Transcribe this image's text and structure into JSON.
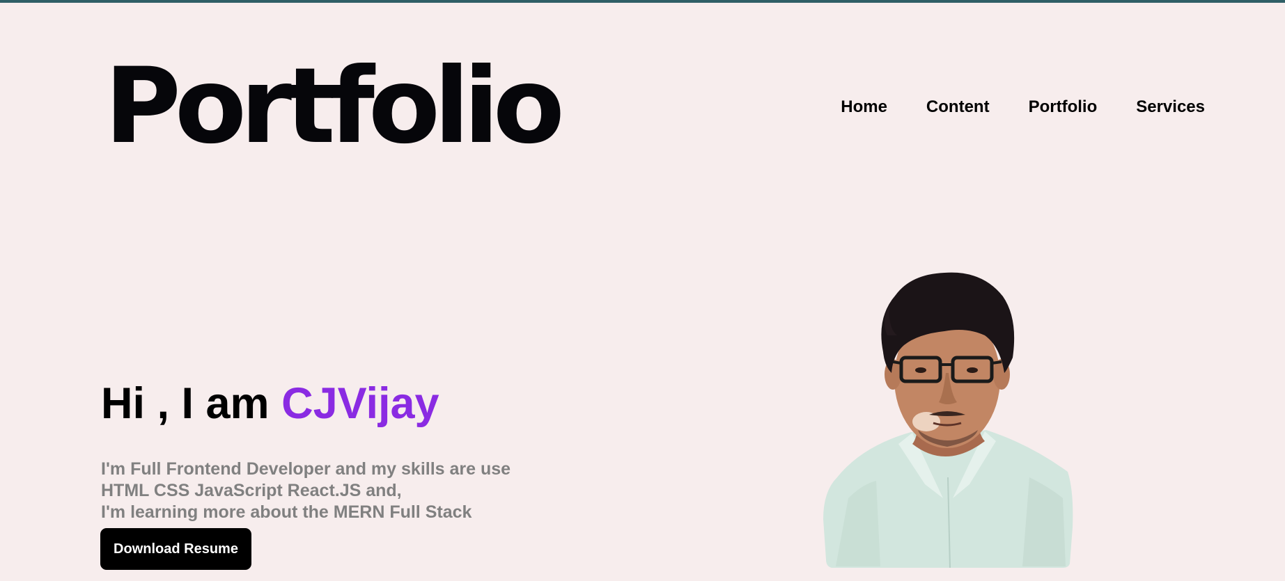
{
  "header": {
    "logo_text": "Portfolio",
    "nav": [
      {
        "label": "Home"
      },
      {
        "label": "Content"
      },
      {
        "label": "Portfolio"
      },
      {
        "label": "Services"
      }
    ]
  },
  "hero": {
    "greeting": "Hi , I am ",
    "name": "CJVijay",
    "description_lines": [
      "I'm Full Frontend Developer and my skills are use",
      "HTML CSS JavaScript React.JS and,",
      "I'm learning more about the MERN Full Stack"
    ],
    "download_button": "Download Resume",
    "portrait_icon": "profile-photo"
  },
  "colors": {
    "background": "#f7eded",
    "top_border": "#2f5f66",
    "accent_name": "#8a2be2",
    "description_text": "#808080",
    "button_background": "#000000",
    "button_text": "#ffffff"
  }
}
